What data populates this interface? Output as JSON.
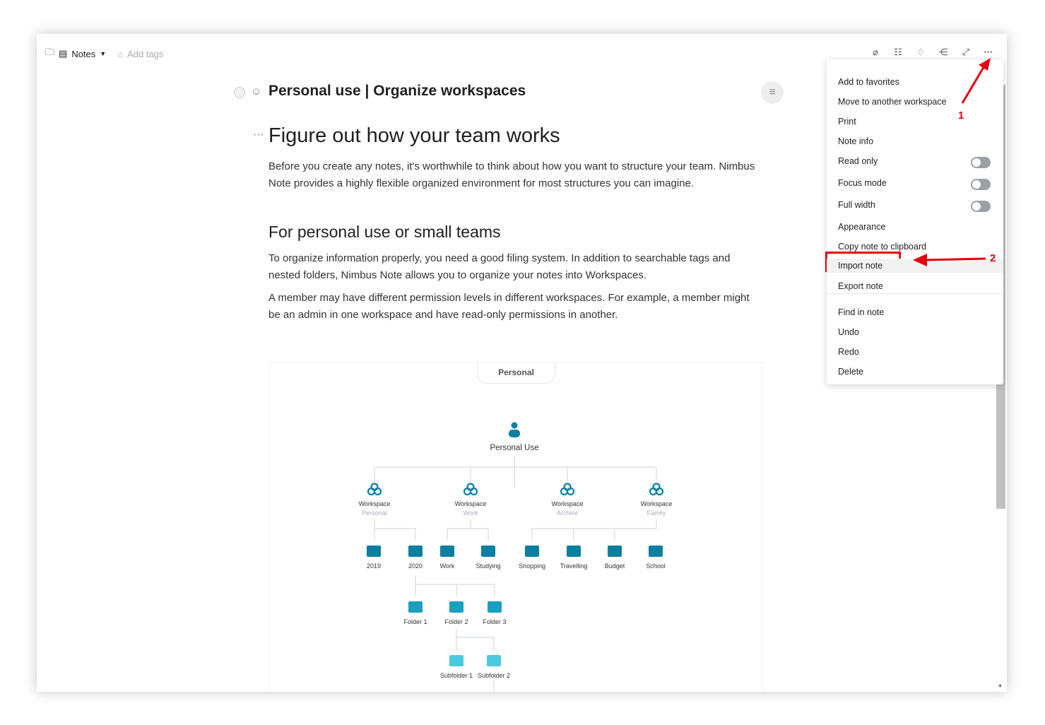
{
  "topbar": {
    "folder_icon": "folder-icon",
    "note_icon": "note-icon",
    "notebook": "Notes",
    "add_tags": "Add tags"
  },
  "toolbar_icons": [
    "paperclip-icon",
    "outline-icon",
    "bell-icon",
    "share-icon",
    "expand-icon",
    "more-icon"
  ],
  "note": {
    "title": "Personal use | Organize workspaces",
    "h1": "Figure out how your team works",
    "p1": "Before you create any notes, it's worthwhile to think about how you want to structure your team. Nimbus Note provides a highly flexible organized environment for most structures you can imagine.",
    "h2": "For personal use or small teams",
    "p2": "To organize information properly, you need a good filing system. In addition to searchable tags and nested folders, Nimbus Note allows you to organize your notes into Workspaces.",
    "p3": "A member may have different permission levels in different workspaces. For example, a member might be an admin in one workspace and have read-only permissions in another."
  },
  "menu": {
    "items": [
      "Add to favorites",
      "Move to another workspace",
      "Print",
      "Note info",
      "Read only",
      "Focus mode",
      "Full width",
      "Appearance",
      "Copy note to clipboard",
      "Import note",
      "Export note",
      "Find in note",
      "Undo",
      "Redo",
      "Delete"
    ],
    "toggles": {
      "read_only": false,
      "focus_mode": false,
      "full_width": false
    },
    "highlighted": "Import note"
  },
  "annotations": {
    "step1": "1",
    "step2": "2",
    "color": "#e3000f"
  },
  "diagram": {
    "tab": "Personal",
    "root": "Personal Use",
    "workspace_label": "Workspace",
    "workspaces": [
      "Personal",
      "Work",
      "Archive",
      "Family"
    ],
    "folders": [
      "2019",
      "2020",
      "Work",
      "Studying",
      "Shopping",
      "Travelling",
      "Budget",
      "School"
    ],
    "subfolders": [
      "Folder 1",
      "Folder 2",
      "Folder 3"
    ],
    "subsubfolders": [
      "Subfolder 1",
      "Subfolder 2"
    ],
    "accent": "#0b7fa0"
  }
}
